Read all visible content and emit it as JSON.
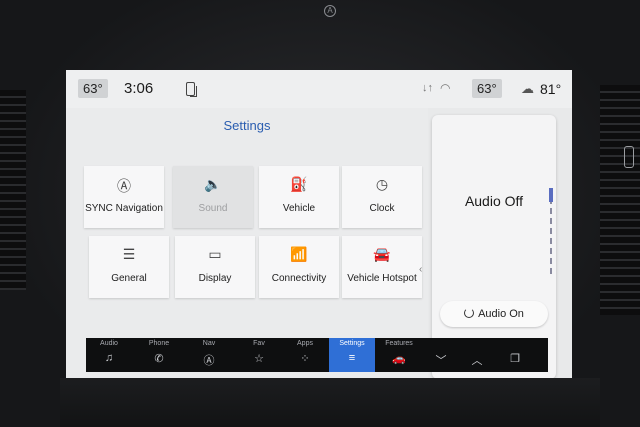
{
  "status_bar": {
    "cabin_temp_left": "63°",
    "time": "3:06",
    "cabin_temp_right": "63°",
    "outside_temp": "81°",
    "icons": [
      "phone-icon",
      "signal-icon",
      "wifi-icon",
      "weather-icon"
    ]
  },
  "main": {
    "title": "Settings",
    "tiles": [
      {
        "label": "SYNC Navigation",
        "icon": "Ⓐ"
      },
      {
        "label": "Sound",
        "icon": "🔈"
      },
      {
        "label": "Vehicle",
        "icon": "⛽"
      },
      {
        "label": "Clock",
        "icon": "◷"
      },
      {
        "label": "General",
        "icon": "☰"
      },
      {
        "label": "Display",
        "icon": "▭"
      },
      {
        "label": "Connectivity",
        "icon": "📶"
      },
      {
        "label": "Vehicle Hotspot",
        "icon": "🚘"
      }
    ]
  },
  "audio": {
    "status": "Audio Off",
    "button_label": "Audio On"
  },
  "navbar": {
    "items": [
      {
        "label": "Audio",
        "icon": "♫"
      },
      {
        "label": "Phone",
        "icon": "✆"
      },
      {
        "label": "Nav",
        "icon": "Ⓐ"
      },
      {
        "label": "Fav",
        "icon": "☆"
      },
      {
        "label": "Apps",
        "icon": "⁘"
      },
      {
        "label": "Settings",
        "icon": "≡"
      },
      {
        "label": "Features",
        "icon": "🚗"
      },
      {
        "label": "",
        "icon": "﹀"
      },
      {
        "label": "",
        "icon": "︿"
      },
      {
        "label": "",
        "icon": "❐"
      }
    ],
    "active_index": 5
  },
  "colors": {
    "accent": "#2f6fd6",
    "title_blue": "#2a5db0"
  }
}
